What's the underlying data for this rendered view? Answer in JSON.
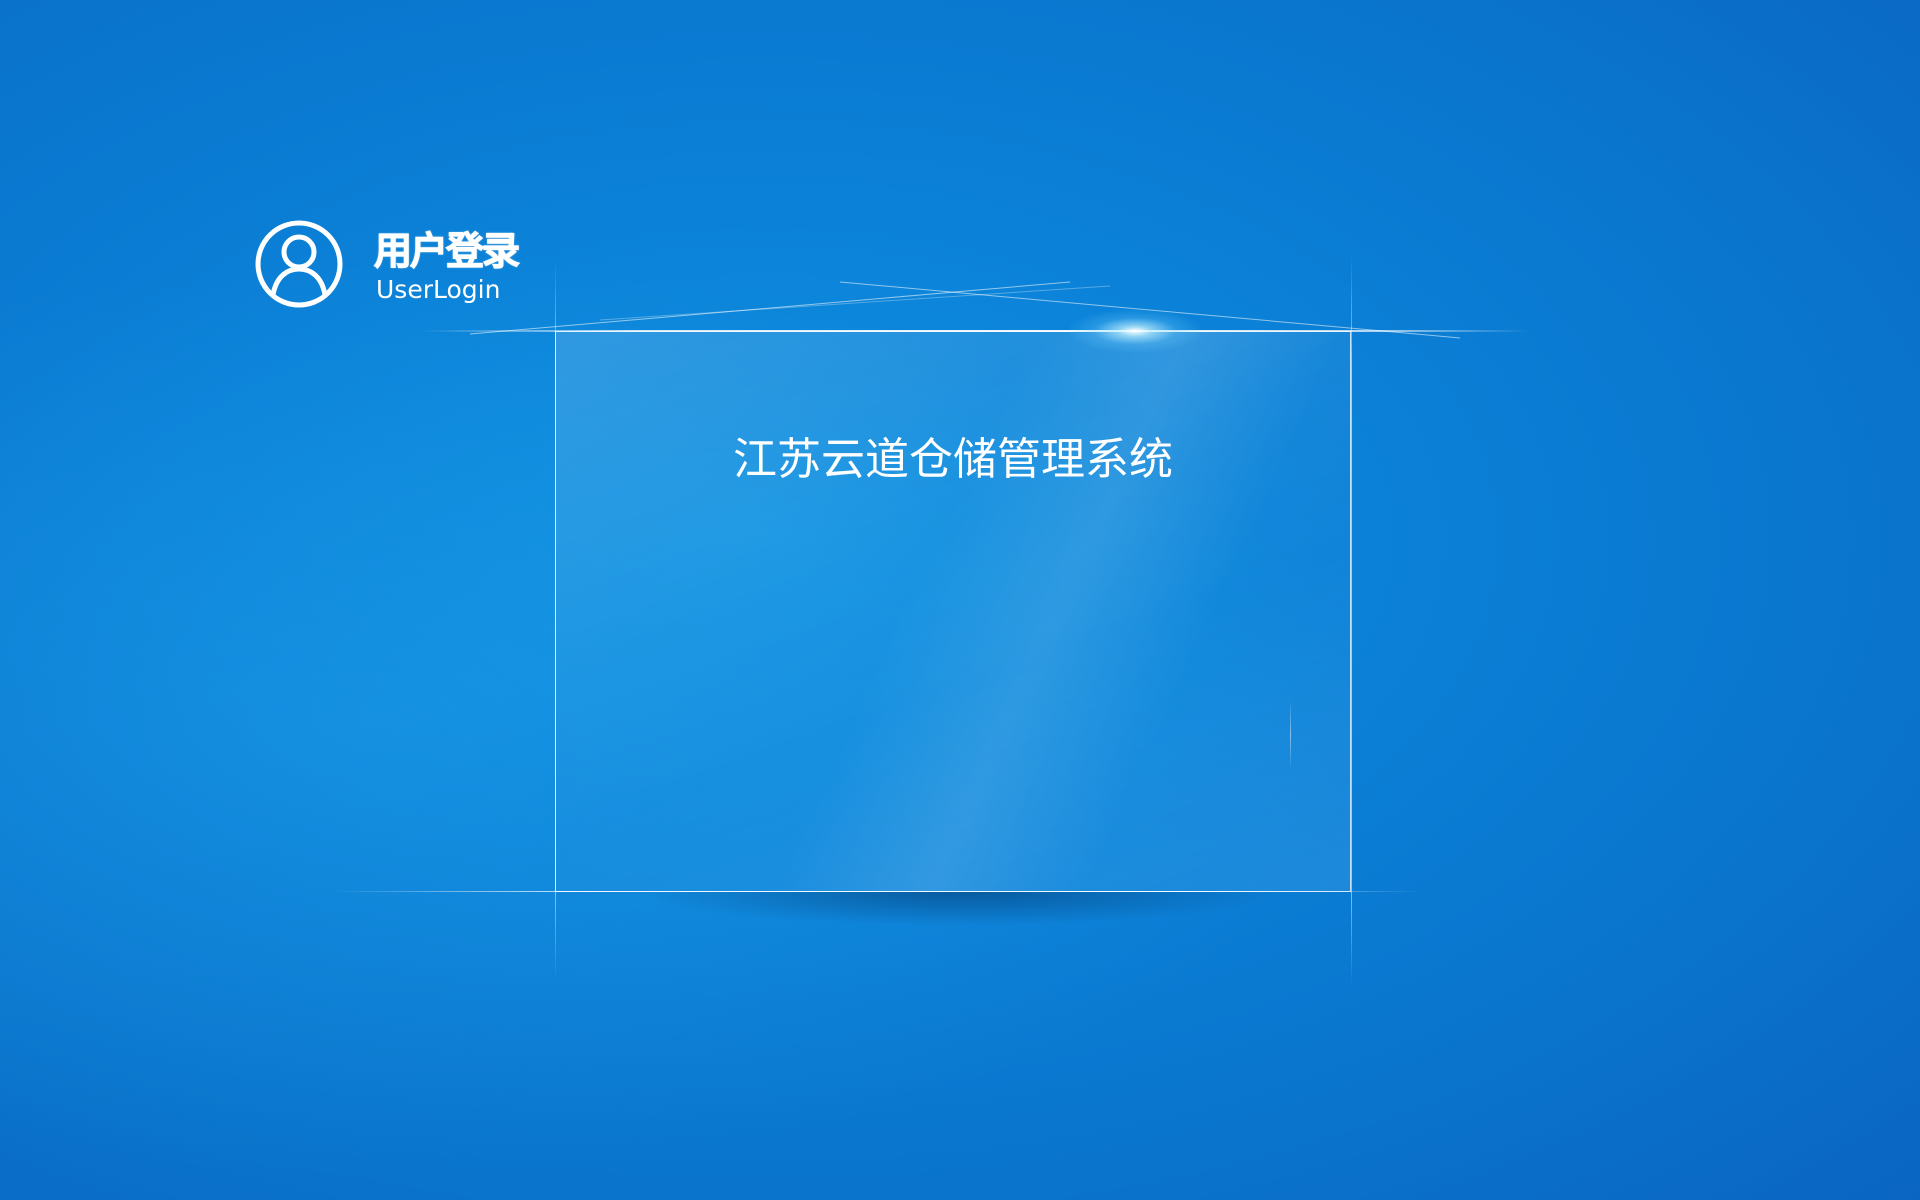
{
  "login_header": {
    "title": "用户登录",
    "subtitle": "UserLogin",
    "icon": "user-avatar-icon"
  },
  "panel": {
    "system_title": "江苏云道仓储管理系统"
  },
  "colors": {
    "background": "#0b82d8",
    "text": "#ffffff",
    "panel_border": "#ffffff"
  }
}
